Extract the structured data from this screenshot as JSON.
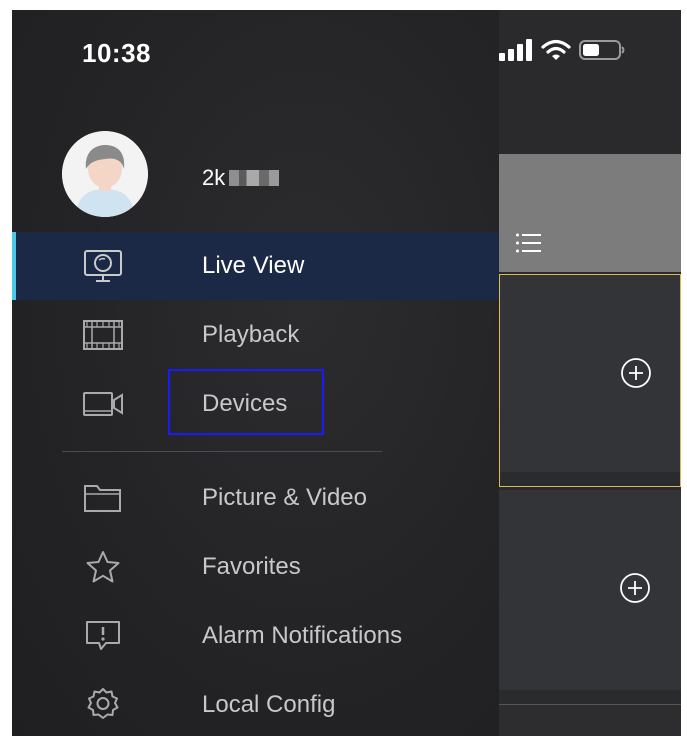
{
  "status_bar": {
    "time": "10:38",
    "icons": [
      "cellular-signal-icon",
      "wifi-icon",
      "battery-icon"
    ]
  },
  "user": {
    "name_visible": "2k",
    "avatar": "avatar-icon"
  },
  "menu": {
    "items": [
      {
        "label": "Live View",
        "icon": "monitor-icon",
        "active": true
      },
      {
        "label": "Playback",
        "icon": "film-icon",
        "active": false
      },
      {
        "label": "Devices",
        "icon": "camera-icon",
        "active": false
      },
      {
        "label": "Picture & Video",
        "icon": "folder-icon",
        "active": false
      },
      {
        "label": "Favorites",
        "icon": "star-icon",
        "active": false
      },
      {
        "label": "Alarm Notifications",
        "icon": "alarm-icon",
        "active": false
      },
      {
        "label": "Local Config",
        "icon": "gear-icon",
        "active": false
      }
    ]
  },
  "live_view_panel": {
    "menu_icon": "list-icon",
    "slots": [
      "add-channel-icon",
      "add-channel-icon"
    ]
  },
  "colors": {
    "active_bg": "#1b2947",
    "active_accent": "#4cc9e8",
    "selected_slot_border": "#d9b95a",
    "highlight_box": "#1a1aff"
  }
}
